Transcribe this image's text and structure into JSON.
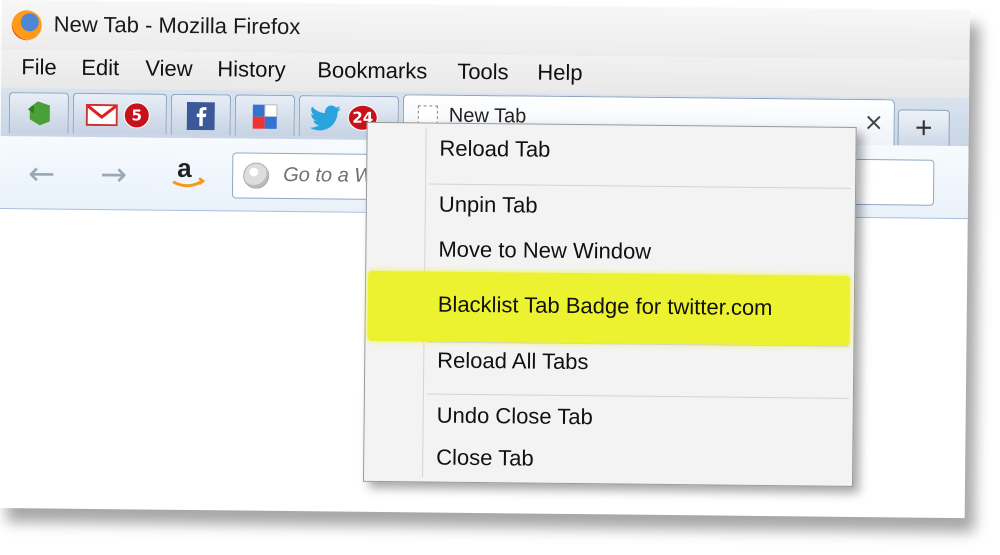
{
  "window": {
    "title": "New Tab - Mozilla Firefox"
  },
  "menubar": [
    "File",
    "Edit",
    "View",
    "History",
    "Bookmarks",
    "Tools",
    "Help"
  ],
  "app_tabs": [
    {
      "name": "evernote",
      "badge": ""
    },
    {
      "name": "gmail",
      "badge": "5"
    },
    {
      "name": "facebook",
      "badge": ""
    },
    {
      "name": "delicious",
      "badge": ""
    },
    {
      "name": "twitter",
      "badge": "24"
    }
  ],
  "active_tab": {
    "label": "New Tab",
    "close": "×"
  },
  "new_tab_button": "+",
  "navbar": {
    "back_icon": "back-arrow-icon",
    "forward_icon": "forward-arrow-icon",
    "url_placeholder": "Go to a Website"
  },
  "context_menu": {
    "items": [
      {
        "label": "Reload Tab",
        "highlight": false
      },
      {
        "label": "Unpin Tab",
        "highlight": false
      },
      {
        "label": "Move to New Window",
        "highlight": false
      },
      {
        "label": "Blacklist Tab Badge for twitter.com",
        "highlight": true
      },
      {
        "label": "Reload All Tabs",
        "highlight": false
      },
      {
        "label": "Undo Close Tab",
        "highlight": false
      },
      {
        "label": "Close Tab",
        "highlight": false
      }
    ]
  },
  "colors": {
    "highlight": "#ecf230",
    "badge": "#c8121b",
    "tab_strip": "#c9d6e6"
  }
}
